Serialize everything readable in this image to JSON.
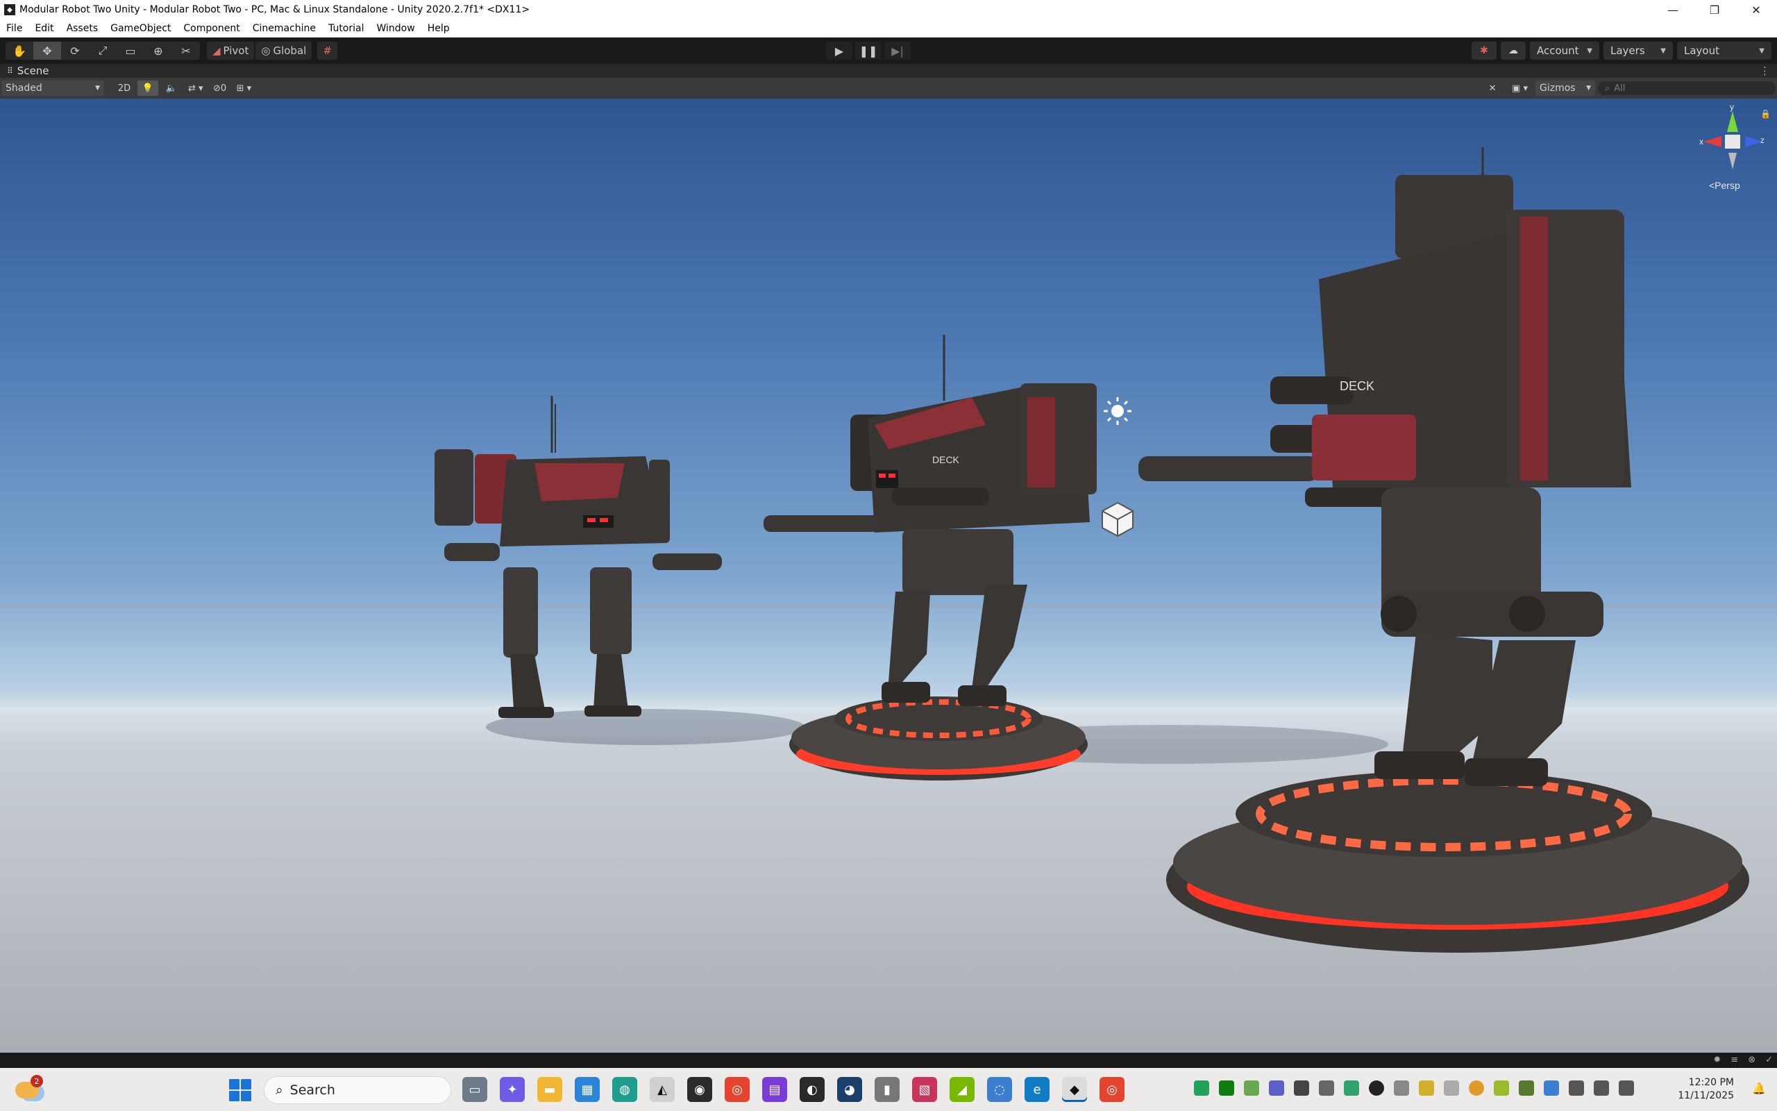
{
  "window": {
    "title": "Modular Robot Two Unity - Modular Robot Two - PC, Mac & Linux Standalone - Unity 2020.2.7f1* <DX11>",
    "minimize": "—",
    "maximize": "❐",
    "close": "✕"
  },
  "menu": [
    "File",
    "Edit",
    "Assets",
    "GameObject",
    "Component",
    "Cinemachine",
    "Tutorial",
    "Window",
    "Help"
  ],
  "toolbar": {
    "pivot_label": "Pivot",
    "global_label": "Global",
    "account_label": "Account",
    "layers_label": "Layers",
    "layout_label": "Layout"
  },
  "scene_panel": {
    "tab_label": "Scene",
    "shading_mode": "Shaded",
    "mode_2d": "2D",
    "hidden_count": "0",
    "gizmos_label": "Gizmos",
    "search_placeholder": "All",
    "persp_label": "<Persp",
    "axis_x": "x",
    "axis_y": "y",
    "axis_z": "z"
  },
  "decals": {
    "deck_1": "DECK",
    "deck_2": "DECK"
  },
  "taskbar": {
    "search_label": "Search",
    "weather_badge": "2",
    "time": "12:20 PM",
    "date": "11/11/2025"
  },
  "colors": {
    "sky_top": "#2f5591",
    "ground": "#b9bec4",
    "robot_body": "#3a3634",
    "robot_accent": "#8a2a2e",
    "pad_glow": "#ff3b2a"
  }
}
